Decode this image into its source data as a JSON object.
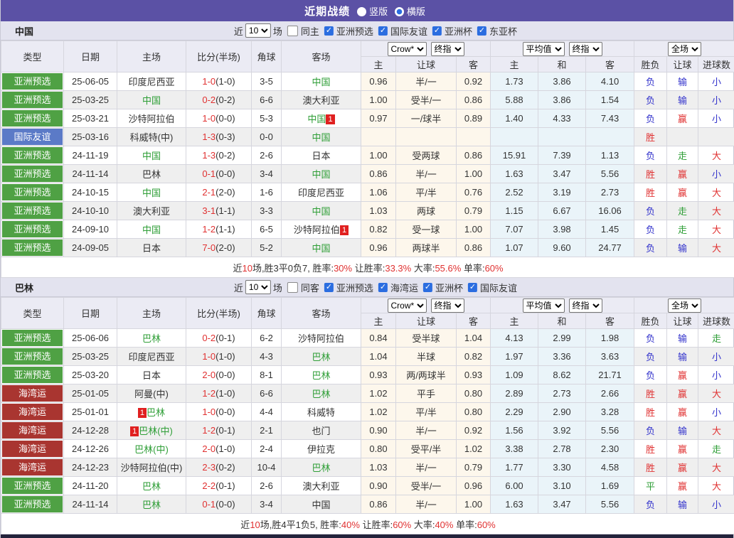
{
  "title_bar": {
    "title": "近期战绩",
    "radios": [
      {
        "label": "竖版",
        "checked": false
      },
      {
        "label": "横版",
        "checked": true
      }
    ]
  },
  "colors": {
    "accent_purple": "#5b51a5",
    "badge_green": "#4fa144",
    "badge_blue": "#5b7ac7",
    "badge_darkred": "#a93530",
    "team_green": "#2e9e36",
    "score_red": "#e03131",
    "result_blue": "#3333cc",
    "odds_bg_cream": "#fdf7ec",
    "avg_bg_blue": "#eaf4f9"
  },
  "column_headers": {
    "left": [
      "类型",
      "日期",
      "主场",
      "比分(半场)",
      "角球",
      "客场"
    ],
    "sub": [
      "主",
      "让球",
      "客",
      "主",
      "和",
      "客",
      "胜负",
      "让球",
      "进球数"
    ],
    "group_selects": [
      [
        "Crow*",
        "终指"
      ],
      [
        "平均值",
        "终指"
      ],
      [
        "全场"
      ]
    ]
  },
  "tables": [
    {
      "team": "中国",
      "filter": {
        "near": "近",
        "count": "10",
        "games": "场",
        "same_label": "同主",
        "same_checked": false,
        "comps": [
          "亚洲预选",
          "国际友谊",
          "亚洲杯",
          "东亚杯"
        ]
      },
      "rows": [
        {
          "type": "亚洲预选",
          "type_color": "green",
          "date": "25-06-05",
          "home": {
            "text": "印度尼西亚",
            "green": false
          },
          "score": "1-0",
          "half": "(1-0)",
          "corner": "3-5",
          "away": {
            "text": "中国",
            "green": true
          },
          "odds": [
            "0.96",
            "半/一",
            "0.92"
          ],
          "avg": [
            "1.73",
            "3.86",
            "4.10"
          ],
          "results": [
            [
              "负",
              "b"
            ],
            [
              "输",
              "b"
            ],
            [
              "小",
              "b"
            ]
          ]
        },
        {
          "type": "亚洲预选",
          "type_color": "green",
          "date": "25-03-25",
          "home": {
            "text": "中国",
            "green": true
          },
          "score": "0-2",
          "half": "(0-2)",
          "corner": "6-6",
          "away": {
            "text": "澳大利亚",
            "green": false
          },
          "odds": [
            "1.00",
            "受半/一",
            "0.86"
          ],
          "avg": [
            "5.88",
            "3.86",
            "1.54"
          ],
          "results": [
            [
              "负",
              "b"
            ],
            [
              "输",
              "b"
            ],
            [
              "小",
              "b"
            ]
          ]
        },
        {
          "type": "亚洲预选",
          "type_color": "green",
          "date": "25-03-21",
          "home": {
            "text": "沙特阿拉伯",
            "green": false
          },
          "score": "1-0",
          "half": "(0-0)",
          "corner": "5-3",
          "away": {
            "text": "中国",
            "green": true,
            "badge": "1",
            "badge_pos": "after"
          },
          "odds": [
            "0.97",
            "一/球半",
            "0.89"
          ],
          "avg": [
            "1.40",
            "4.33",
            "7.43"
          ],
          "results": [
            [
              "负",
              "b"
            ],
            [
              "赢",
              "r"
            ],
            [
              "小",
              "b"
            ]
          ]
        },
        {
          "type": "国际友谊",
          "type_color": "blue",
          "date": "25-03-16",
          "home": {
            "text": "科威特(中)",
            "green": false
          },
          "score": "1-3",
          "half": "(0-3)",
          "corner": "0-0",
          "away": {
            "text": "中国",
            "green": true
          },
          "odds": [
            "",
            "",
            ""
          ],
          "avg": [
            "",
            "",
            ""
          ],
          "results": [
            [
              "胜",
              "r"
            ],
            [
              "",
              ""
            ],
            [
              "",
              ""
            ]
          ]
        },
        {
          "type": "亚洲预选",
          "type_color": "green",
          "date": "24-11-19",
          "home": {
            "text": "中国",
            "green": true
          },
          "score": "1-3",
          "half": "(0-2)",
          "corner": "2-6",
          "away": {
            "text": "日本",
            "green": false
          },
          "odds": [
            "1.00",
            "受两球",
            "0.86"
          ],
          "avg": [
            "15.91",
            "7.39",
            "1.13"
          ],
          "results": [
            [
              "负",
              "b"
            ],
            [
              "走",
              "g"
            ],
            [
              "大",
              "r"
            ]
          ]
        },
        {
          "type": "亚洲预选",
          "type_color": "green",
          "date": "24-11-14",
          "home": {
            "text": "巴林",
            "green": false
          },
          "score": "0-1",
          "half": "(0-0)",
          "corner": "3-4",
          "away": {
            "text": "中国",
            "green": true
          },
          "odds": [
            "0.86",
            "半/一",
            "1.00"
          ],
          "avg": [
            "1.63",
            "3.47",
            "5.56"
          ],
          "results": [
            [
              "胜",
              "r"
            ],
            [
              "赢",
              "r"
            ],
            [
              "小",
              "b"
            ]
          ]
        },
        {
          "type": "亚洲预选",
          "type_color": "green",
          "date": "24-10-15",
          "home": {
            "text": "中国",
            "green": true
          },
          "score": "2-1",
          "half": "(2-0)",
          "corner": "1-6",
          "away": {
            "text": "印度尼西亚",
            "green": false
          },
          "odds": [
            "1.06",
            "平/半",
            "0.76"
          ],
          "avg": [
            "2.52",
            "3.19",
            "2.73"
          ],
          "results": [
            [
              "胜",
              "r"
            ],
            [
              "赢",
              "r"
            ],
            [
              "大",
              "r"
            ]
          ]
        },
        {
          "type": "亚洲预选",
          "type_color": "green",
          "date": "24-10-10",
          "home": {
            "text": "澳大利亚",
            "green": false
          },
          "score": "3-1",
          "half": "(1-1)",
          "corner": "3-3",
          "away": {
            "text": "中国",
            "green": true
          },
          "odds": [
            "1.03",
            "两球",
            "0.79"
          ],
          "avg": [
            "1.15",
            "6.67",
            "16.06"
          ],
          "results": [
            [
              "负",
              "b"
            ],
            [
              "走",
              "g"
            ],
            [
              "大",
              "r"
            ]
          ]
        },
        {
          "type": "亚洲预选",
          "type_color": "green",
          "date": "24-09-10",
          "home": {
            "text": "中国",
            "green": true
          },
          "score": "1-2",
          "half": "(1-1)",
          "corner": "6-5",
          "away": {
            "text": "沙特阿拉伯",
            "green": false,
            "badge": "1",
            "badge_pos": "after"
          },
          "odds": [
            "0.82",
            "受一球",
            "1.00"
          ],
          "avg": [
            "7.07",
            "3.98",
            "1.45"
          ],
          "results": [
            [
              "负",
              "b"
            ],
            [
              "走",
              "g"
            ],
            [
              "大",
              "r"
            ]
          ]
        },
        {
          "type": "亚洲预选",
          "type_color": "green",
          "date": "24-09-05",
          "home": {
            "text": "日本",
            "green": false
          },
          "score": "7-0",
          "half": "(2-0)",
          "corner": "5-2",
          "away": {
            "text": "中国",
            "green": true
          },
          "odds": [
            "0.96",
            "两球半",
            "0.86"
          ],
          "avg": [
            "1.07",
            "9.60",
            "24.77"
          ],
          "results": [
            [
              "负",
              "b"
            ],
            [
              "输",
              "b"
            ],
            [
              "大",
              "r"
            ]
          ]
        }
      ],
      "summary": [
        [
          "近",
          "k"
        ],
        [
          "10",
          "r"
        ],
        [
          "场,胜3平0负7, 胜率:",
          "k"
        ],
        [
          "30%",
          "r"
        ],
        [
          " 让胜率:",
          "k"
        ],
        [
          "33.3%",
          "r"
        ],
        [
          " 大率:",
          "k"
        ],
        [
          "55.6%",
          "r"
        ],
        [
          " 单率:",
          "k"
        ],
        [
          "60%",
          "r"
        ]
      ]
    },
    {
      "team": "巴林",
      "filter": {
        "near": "近",
        "count": "10",
        "games": "场",
        "same_label": "同客",
        "same_checked": false,
        "comps": [
          "亚洲预选",
          "海湾运",
          "亚洲杯",
          "国际友谊"
        ]
      },
      "rows": [
        {
          "type": "亚洲预选",
          "type_color": "green",
          "date": "25-06-06",
          "home": {
            "text": "巴林",
            "green": true
          },
          "score": "0-2",
          "half": "(0-1)",
          "corner": "6-2",
          "away": {
            "text": "沙特阿拉伯",
            "green": false
          },
          "odds": [
            "0.84",
            "受半球",
            "1.04"
          ],
          "avg": [
            "4.13",
            "2.99",
            "1.98"
          ],
          "results": [
            [
              "负",
              "b"
            ],
            [
              "输",
              "b"
            ],
            [
              "走",
              "g"
            ]
          ]
        },
        {
          "type": "亚洲预选",
          "type_color": "green",
          "date": "25-03-25",
          "home": {
            "text": "印度尼西亚",
            "green": false
          },
          "score": "1-0",
          "half": "(1-0)",
          "corner": "4-3",
          "away": {
            "text": "巴林",
            "green": true
          },
          "odds": [
            "1.04",
            "半球",
            "0.82"
          ],
          "avg": [
            "1.97",
            "3.36",
            "3.63"
          ],
          "results": [
            [
              "负",
              "b"
            ],
            [
              "输",
              "b"
            ],
            [
              "小",
              "b"
            ]
          ]
        },
        {
          "type": "亚洲预选",
          "type_color": "green",
          "date": "25-03-20",
          "home": {
            "text": "日本",
            "green": false
          },
          "score": "2-0",
          "half": "(0-0)",
          "corner": "8-1",
          "away": {
            "text": "巴林",
            "green": true
          },
          "odds": [
            "0.93",
            "两/两球半",
            "0.93"
          ],
          "avg": [
            "1.09",
            "8.62",
            "21.71"
          ],
          "results": [
            [
              "负",
              "b"
            ],
            [
              "赢",
              "r"
            ],
            [
              "小",
              "b"
            ]
          ]
        },
        {
          "type": "海湾运",
          "type_color": "darkred",
          "date": "25-01-05",
          "home": {
            "text": "阿曼(中)",
            "green": false
          },
          "score": "1-2",
          "half": "(1-0)",
          "corner": "6-6",
          "away": {
            "text": "巴林",
            "green": true
          },
          "odds": [
            "1.02",
            "平手",
            "0.80"
          ],
          "avg": [
            "2.89",
            "2.73",
            "2.66"
          ],
          "results": [
            [
              "胜",
              "r"
            ],
            [
              "赢",
              "r"
            ],
            [
              "大",
              "r"
            ]
          ]
        },
        {
          "type": "海湾运",
          "type_color": "darkred",
          "date": "25-01-01",
          "home": {
            "text": "巴林",
            "green": true,
            "badge": "1",
            "badge_pos": "before"
          },
          "score": "1-0",
          "half": "(0-0)",
          "corner": "4-4",
          "away": {
            "text": "科威特",
            "green": false
          },
          "odds": [
            "1.02",
            "平/半",
            "0.80"
          ],
          "avg": [
            "2.29",
            "2.90",
            "3.28"
          ],
          "results": [
            [
              "胜",
              "r"
            ],
            [
              "赢",
              "r"
            ],
            [
              "小",
              "b"
            ]
          ]
        },
        {
          "type": "海湾运",
          "type_color": "darkred",
          "date": "24-12-28",
          "home": {
            "text": "巴林(中)",
            "green": true,
            "badge": "1",
            "badge_pos": "before"
          },
          "score": "1-2",
          "half": "(0-1)",
          "corner": "2-1",
          "away": {
            "text": "也门",
            "green": false
          },
          "odds": [
            "0.90",
            "半/一",
            "0.92"
          ],
          "avg": [
            "1.56",
            "3.92",
            "5.56"
          ],
          "results": [
            [
              "负",
              "b"
            ],
            [
              "输",
              "b"
            ],
            [
              "大",
              "r"
            ]
          ]
        },
        {
          "type": "海湾运",
          "type_color": "darkred",
          "date": "24-12-26",
          "home": {
            "text": "巴林(中)",
            "green": true
          },
          "score": "2-0",
          "half": "(1-0)",
          "corner": "2-4",
          "away": {
            "text": "伊拉克",
            "green": false
          },
          "odds": [
            "0.80",
            "受平/半",
            "1.02"
          ],
          "avg": [
            "3.38",
            "2.78",
            "2.30"
          ],
          "results": [
            [
              "胜",
              "r"
            ],
            [
              "赢",
              "r"
            ],
            [
              "走",
              "g"
            ]
          ]
        },
        {
          "type": "海湾运",
          "type_color": "darkred",
          "date": "24-12-23",
          "home": {
            "text": "沙特阿拉伯(中)",
            "green": false
          },
          "score": "2-3",
          "half": "(0-2)",
          "corner": "10-4",
          "away": {
            "text": "巴林",
            "green": true
          },
          "odds": [
            "1.03",
            "半/一",
            "0.79"
          ],
          "avg": [
            "1.77",
            "3.30",
            "4.58"
          ],
          "results": [
            [
              "胜",
              "r"
            ],
            [
              "赢",
              "r"
            ],
            [
              "大",
              "r"
            ]
          ]
        },
        {
          "type": "亚洲预选",
          "type_color": "green",
          "date": "24-11-20",
          "home": {
            "text": "巴林",
            "green": true
          },
          "score": "2-2",
          "half": "(0-1)",
          "corner": "2-6",
          "away": {
            "text": "澳大利亚",
            "green": false
          },
          "odds": [
            "0.90",
            "受半/一",
            "0.96"
          ],
          "avg": [
            "6.00",
            "3.10",
            "1.69"
          ],
          "results": [
            [
              "平",
              "g"
            ],
            [
              "赢",
              "r"
            ],
            [
              "大",
              "r"
            ]
          ]
        },
        {
          "type": "亚洲预选",
          "type_color": "green",
          "date": "24-11-14",
          "home": {
            "text": "巴林",
            "green": true
          },
          "score": "0-1",
          "half": "(0-0)",
          "corner": "3-4",
          "away": {
            "text": "中国",
            "green": false
          },
          "odds": [
            "0.86",
            "半/一",
            "1.00"
          ],
          "avg": [
            "1.63",
            "3.47",
            "5.56"
          ],
          "results": [
            [
              "负",
              "b"
            ],
            [
              "输",
              "b"
            ],
            [
              "小",
              "b"
            ]
          ]
        }
      ],
      "summary": [
        [
          "近",
          "k"
        ],
        [
          "10",
          "r"
        ],
        [
          "场,胜4平1负5, 胜率:",
          "k"
        ],
        [
          "40%",
          "r"
        ],
        [
          " 让胜率:",
          "k"
        ],
        [
          "60%",
          "r"
        ],
        [
          " 大率:",
          "k"
        ],
        [
          "40%",
          "r"
        ],
        [
          " 单率:",
          "k"
        ],
        [
          "60%",
          "r"
        ]
      ]
    }
  ]
}
